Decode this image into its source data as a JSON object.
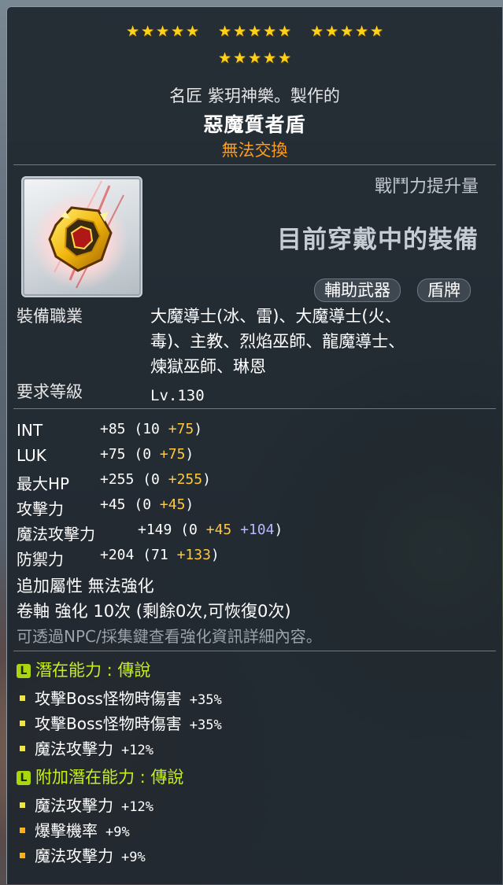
{
  "stars": {
    "group_count": 4,
    "stars_per_group": 5,
    "total": 20,
    "color": "#ffd21a"
  },
  "header": {
    "maker": "名匠 紫玥神樂。製作的",
    "item_name": "惡魔質者盾",
    "untradable": "無法交換"
  },
  "power": {
    "label": "戰鬥力提升量",
    "equipped_text": "目前穿戴中的裝備"
  },
  "item_icon": "demon-avenger-shield-icon",
  "badges": [
    "輔助武器",
    "盾牌"
  ],
  "requirements": {
    "job_label": "裝備職業",
    "jobs_lines": [
      "大魔導士(冰、雷)、大魔導士(火、",
      "毒)、主教、烈焰巫師、龍魔導士、",
      "煉獄巫師、琳恩"
    ],
    "level_label": "要求等級",
    "level": "Lv.130"
  },
  "stats": [
    {
      "name": "INT",
      "total": "+85",
      "open": "(10",
      "parts": [
        {
          "text": "+75",
          "color": "gold"
        }
      ],
      "close": ")"
    },
    {
      "name": "LUK",
      "total": "+75",
      "open": "(0",
      "parts": [
        {
          "text": "+75",
          "color": "gold"
        }
      ],
      "close": ")"
    },
    {
      "name": "最大HP",
      "total": "+255",
      "open": "(0",
      "parts": [
        {
          "text": "+255",
          "color": "gold"
        }
      ],
      "close": ")"
    },
    {
      "name": "攻擊力",
      "total": "+45",
      "open": "(0",
      "parts": [
        {
          "text": "+45",
          "color": "gold"
        }
      ],
      "close": ")"
    },
    {
      "name": "魔法攻擊力",
      "total": "+149",
      "open": "(0",
      "parts": [
        {
          "text": "+45",
          "color": "gold"
        },
        {
          "text": "+104",
          "color": "purple"
        }
      ],
      "close": ")"
    },
    {
      "name": "防禦力",
      "total": "+204",
      "open": "(71",
      "parts": [
        {
          "text": "+133",
          "color": "gold"
        }
      ],
      "close": ")"
    }
  ],
  "enhance": {
    "bonus_line": "追加屬性 無法強化",
    "scroll_line": "卷軸 強化 10次 (剩餘0次,可恢復0次)",
    "hint_line": "可透過NPC/採集鍵查看強化資訊詳細內容。"
  },
  "potential": {
    "tag": "L",
    "title": "潛在能力 : 傳說",
    "lines": [
      {
        "name": "攻擊Boss怪物時傷害",
        "value": "+35%"
      },
      {
        "name": "攻擊Boss怪物時傷害",
        "value": "+35%"
      },
      {
        "name": "魔法攻擊力",
        "value": "+12%"
      }
    ]
  },
  "bonus_potential": {
    "tag": "L",
    "title": "附加潛在能力 : 傳說",
    "lines": [
      {
        "name": "魔法攻擊力",
        "value": "+12%"
      },
      {
        "name": "爆擊機率",
        "value": "+9%"
      },
      {
        "name": "魔法攻擊力",
        "value": "+9%"
      }
    ]
  },
  "colors": {
    "gold_stat": "#ffc83a",
    "purple_stat": "#b9b8ff",
    "untradable": "#ff9c1a",
    "potential_green": "#c6f01c"
  }
}
